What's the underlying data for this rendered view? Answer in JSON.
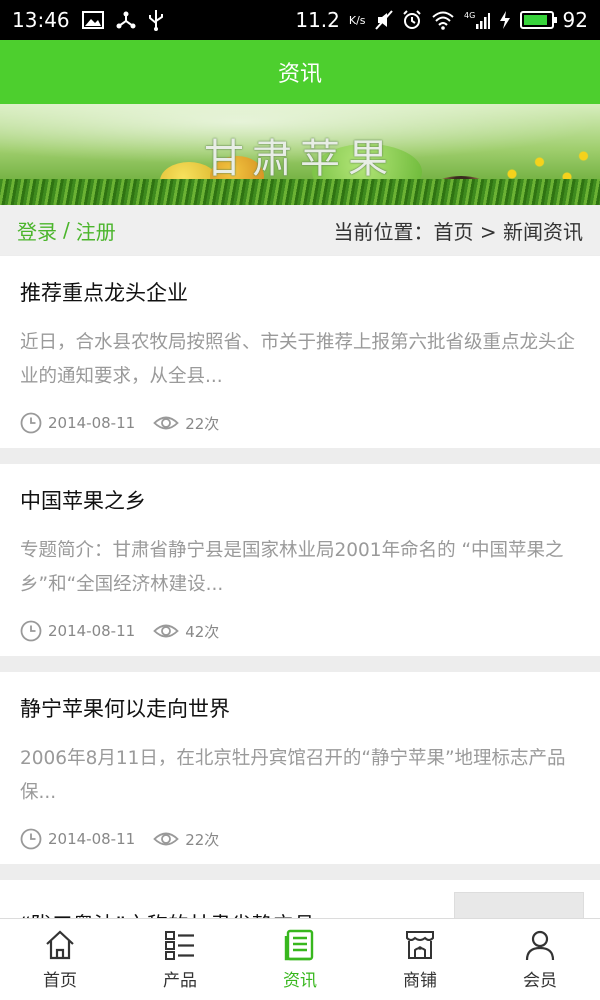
{
  "status_bar": {
    "time": "13:46",
    "speed": "11.2",
    "speed_unit": "K/s",
    "battery_level": "92",
    "battery_fraction": 0.92,
    "icons": [
      "image-icon",
      "usb-share-icon",
      "usb-icon",
      "mute-icon",
      "alarm-icon",
      "wifi-icon",
      "signal-4g-icon",
      "charging-icon",
      "battery-icon"
    ]
  },
  "header": {
    "title": "资讯"
  },
  "banner": {
    "title": "甘肃苹果"
  },
  "location_bar": {
    "login": "登录",
    "separator": "/",
    "register": "注册",
    "breadcrumb": "当前位置：首页 > 新闻资讯"
  },
  "news": [
    {
      "title": "推荐重点龙头企业",
      "summary": "近日，合水县农牧局按照省、市关于推荐上报第六批省级重点龙头企业的通知要求，从全县...",
      "date": "2014-08-11",
      "views": "22次"
    },
    {
      "title": "中国苹果之乡",
      "summary": "专题简介：甘肃省静宁县是国家林业局2001年命名的 “中国苹果之乡”和“全国经济林建设...",
      "date": "2014-08-11",
      "views": "42次"
    },
    {
      "title": "静宁苹果何以走向世界",
      "summary": " 2006年8月11日，在北京牡丹宾馆召开的“静宁苹果”地理标志产品保...",
      "date": "2014-08-11",
      "views": "22次"
    },
    {
      "title": "“陇口粤油”之称的甘肃省静宁县"
    }
  ],
  "bottom_nav": [
    {
      "label": "首页",
      "icon": "home-icon"
    },
    {
      "label": "产品",
      "icon": "list-icon"
    },
    {
      "label": "资讯",
      "icon": "news-icon",
      "active": true
    },
    {
      "label": "商铺",
      "icon": "shop-icon"
    },
    {
      "label": "会员",
      "icon": "user-icon"
    }
  ],
  "colors": {
    "accent": "#4dcf2e",
    "active_nav": "#38b71e",
    "link": "#4bb52c"
  }
}
